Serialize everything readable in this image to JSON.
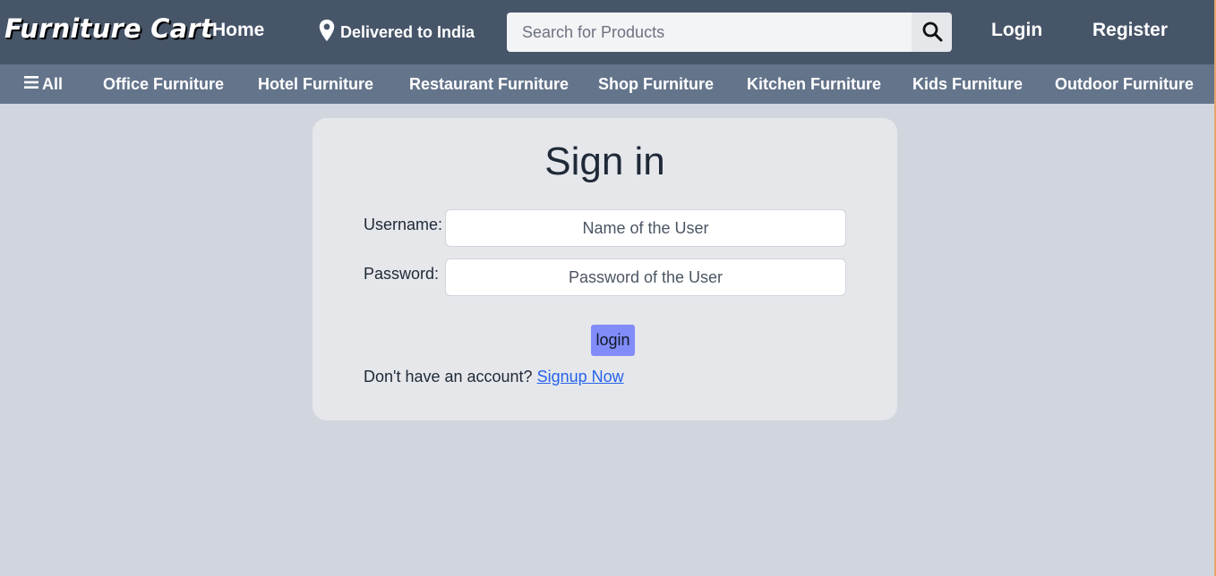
{
  "header": {
    "brand": "Furniture Cart",
    "home_label": "Home",
    "delivery_text": "Delivered to India",
    "search_placeholder": "Search for Products",
    "login_label": "Login",
    "register_label": "Register"
  },
  "categories": {
    "all_label": "All",
    "items": [
      "Office Furniture",
      "Hotel Furniture",
      "Restaurant Furniture",
      "Shop Furniture",
      "Kitchen Furniture",
      "Kids Furniture",
      "Outdoor Furniture"
    ]
  },
  "signin": {
    "title": "Sign in",
    "username_label": "Username:",
    "username_placeholder": "Name of the User",
    "password_label": "Password:",
    "password_placeholder": "Password of the User",
    "login_button": "login",
    "no_account_text": "Don't have an account?",
    "signup_link": "Signup Now"
  },
  "icons": {
    "location": "map-pin-icon",
    "search": "search-icon",
    "menu": "hamburger-menu-icon"
  },
  "colors": {
    "topbar": "#475569",
    "catbar": "#64748b",
    "background": "#d1d5dd",
    "card": "#e5e7eb",
    "login_button": "#818cf8",
    "link": "#2563eb"
  }
}
